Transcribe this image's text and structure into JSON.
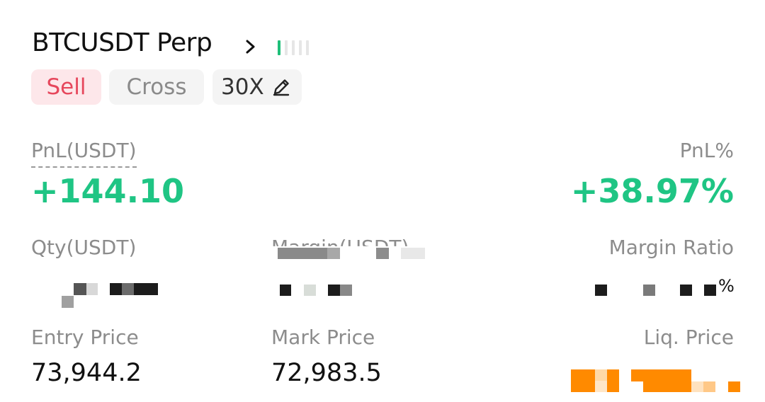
{
  "header": {
    "symbol": "BTCUSDT Perp",
    "chevron_icon": "chevron-right-icon",
    "signal_strength": 0.2,
    "signal_color": "#1fbf79"
  },
  "chips": {
    "side": "Sell",
    "margin_mode": "Cross",
    "leverage": "30X",
    "edit_icon": "pencil-icon"
  },
  "stats": {
    "pnl_label": "PnL(USDT)",
    "pnl_value": "+144.10",
    "pnl_pct_label": "PnL%",
    "pnl_pct_value": "+38.97%",
    "qty_label": "Qty(USDT)",
    "margin_label": "Margin(USDT)",
    "margin_ratio_label": "Margin Ratio",
    "entry_label": "Entry Price",
    "entry_value": "73,944.2",
    "mark_label": "Mark Price",
    "mark_value": "72,983.5",
    "liq_label": "Liq. Price"
  },
  "colors": {
    "positive": "#1fc584",
    "sell": "#e6475c",
    "redaction_orange": "#ff8a00"
  }
}
